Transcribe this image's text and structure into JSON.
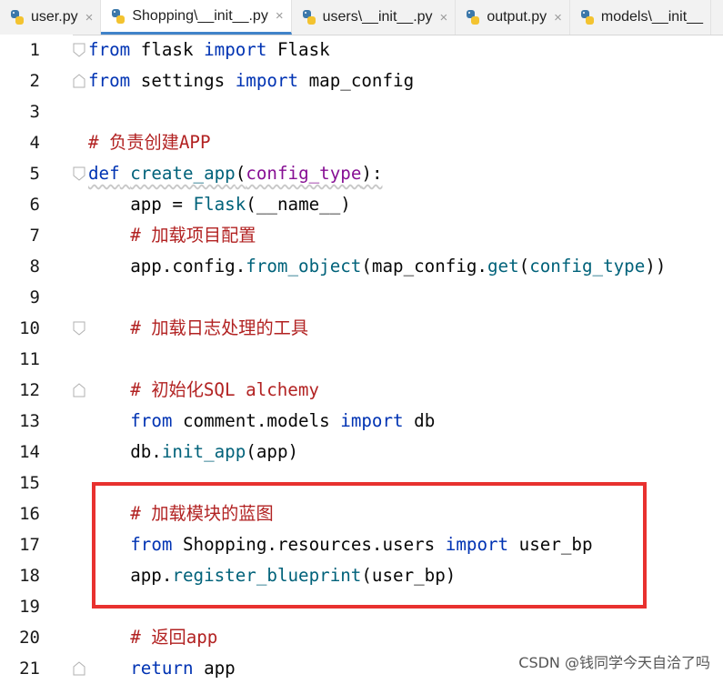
{
  "tabs": [
    {
      "label": "user.py",
      "active": false
    },
    {
      "label": "Shopping\\__init__.py",
      "active": true
    },
    {
      "label": "users\\__init__.py",
      "active": false
    },
    {
      "label": "output.py",
      "active": false
    },
    {
      "label": "models\\__init__",
      "active": false
    }
  ],
  "tab_close_glyph": "×",
  "lines": [
    {
      "num": "1",
      "tokens": [
        [
          "kw",
          "from"
        ],
        [
          "",
          "flask"
        ],
        [
          "kw",
          "import"
        ],
        [
          "",
          "Flask"
        ]
      ]
    },
    {
      "num": "2"
    },
    {
      "num": "3"
    },
    {
      "num": "4"
    },
    {
      "num": "5"
    },
    {
      "num": "6"
    },
    {
      "num": "7"
    },
    {
      "num": "8"
    },
    {
      "num": "9"
    },
    {
      "num": "10"
    },
    {
      "num": "11"
    },
    {
      "num": "12"
    },
    {
      "num": "13"
    },
    {
      "num": "14"
    },
    {
      "num": "15"
    },
    {
      "num": "16"
    },
    {
      "num": "17"
    },
    {
      "num": "18"
    },
    {
      "num": "19"
    },
    {
      "num": "20"
    },
    {
      "num": "21"
    }
  ],
  "code": {
    "l1": {
      "a": "from",
      "b": " flask ",
      "c": "import",
      "d": " Flask"
    },
    "l2": {
      "a": "from",
      "b": " settings ",
      "c": "import",
      "d": " map_config"
    },
    "l4": {
      "a": "# 负责创建APP"
    },
    "l5": {
      "a": "def",
      "b": " ",
      "c": "create_app",
      "d": "(",
      "e": "config_type",
      "f": "):"
    },
    "l6": {
      "a": "    app = ",
      "b": "Flask",
      "c": "(",
      "d": "__name__",
      "e": ")"
    },
    "l7": {
      "a": "    ",
      "b": "# 加载项目配置"
    },
    "l8": {
      "a": "    app.config.",
      "b": "from_object",
      "c": "(map_config.",
      "d": "get",
      "e": "(",
      "f": "config_type",
      "g": "))"
    },
    "l10": {
      "a": "    ",
      "b": "# 加载日志处理的工具"
    },
    "l12": {
      "a": "    ",
      "b": "# 初始化SQL alchemy"
    },
    "l13": {
      "a": "    ",
      "b": "from",
      "c": " comment.models ",
      "d": "import",
      "e": " db"
    },
    "l14": {
      "a": "    db.",
      "b": "init_app",
      "c": "(app)"
    },
    "l16": {
      "a": "    ",
      "b": "# 加载模块的蓝图"
    },
    "l17": {
      "a": "    ",
      "b": "from",
      "c": " Shopping.resources.users ",
      "d": "import",
      "e": " user_bp"
    },
    "l18": {
      "a": "    app.",
      "b": "register_blueprint",
      "c": "(user_bp)"
    },
    "l20": {
      "a": "    ",
      "b": "# 返回app"
    },
    "l21": {
      "a": "    ",
      "b": "return",
      "c": " app"
    }
  },
  "watermark": "CSDN @钱同学今天自洽了吗",
  "colors": {
    "keyword": "#0033b3",
    "function": "#00627a",
    "parameter": "#871094",
    "comment": "#b22222",
    "highlight_box": "#e8312f",
    "active_tab_underline": "#4083c9"
  }
}
